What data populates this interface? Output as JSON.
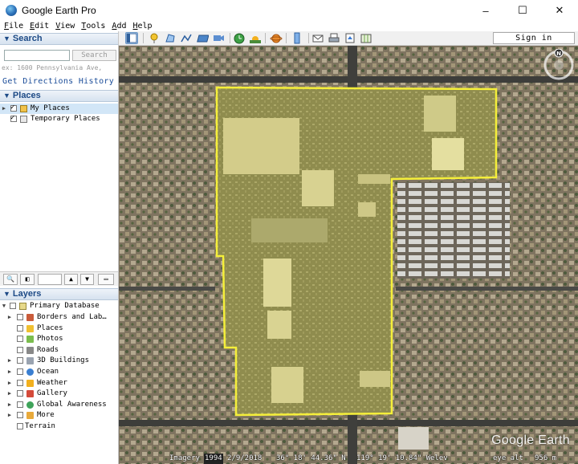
{
  "window": {
    "title": "Google Earth Pro",
    "controls": [
      "–",
      "☐",
      "✕"
    ]
  },
  "menu": {
    "items": [
      {
        "key": "F",
        "rest": "ile"
      },
      {
        "key": "E",
        "rest": "dit"
      },
      {
        "key": "V",
        "rest": "iew"
      },
      {
        "key": "T",
        "rest": "ools"
      },
      {
        "key": "A",
        "rest": "dd"
      },
      {
        "key": "H",
        "rest": "elp"
      }
    ]
  },
  "toolbar": {
    "sign_in_label": "Sign in",
    "icons": [
      "sidebar-toggle-icon",
      "placemark-icon",
      "polygon-icon",
      "path-icon",
      "image-overlay-icon",
      "record-tour-icon",
      "historical-imagery-icon",
      "sunlight-icon",
      "planets-icon",
      "ruler-icon",
      "email-icon",
      "print-icon",
      "save-image-icon",
      "view-in-maps-icon"
    ]
  },
  "search": {
    "header": "Search",
    "placeholder": "",
    "button_label": "Search",
    "hint": "ex: 1600 Pennsylvania Ave,",
    "get_directions": "Get Directions",
    "history": "History"
  },
  "places": {
    "header": "Places",
    "items": [
      {
        "label": "My Places",
        "checked": true,
        "selected": true
      },
      {
        "label": "Temporary Places",
        "checked": true,
        "selected": false
      }
    ]
  },
  "layers": {
    "header": "Layers",
    "root": "Primary Database",
    "items": [
      {
        "label": "Borders and Lab…",
        "icon": "borders-icon",
        "expandable": true
      },
      {
        "label": "Places",
        "icon": "places-layer-icon",
        "expandable": false
      },
      {
        "label": "Photos",
        "icon": "photos-icon",
        "expandable": false
      },
      {
        "label": "Roads",
        "icon": "roads-icon",
        "expandable": false
      },
      {
        "label": "3D Buildings",
        "icon": "buildings-icon",
        "expandable": true
      },
      {
        "label": "Ocean",
        "icon": "ocean-icon",
        "expandable": true
      },
      {
        "label": "Weather",
        "icon": "weather-icon",
        "expandable": true
      },
      {
        "label": "Gallery",
        "icon": "gallery-icon",
        "expandable": true
      },
      {
        "label": "Global Awareness",
        "icon": "global-awareness-icon",
        "expandable": true
      },
      {
        "label": "More",
        "icon": "more-icon",
        "expandable": true
      },
      {
        "label": "Terrain",
        "icon": "terrain-icon",
        "expandable": false
      }
    ]
  },
  "map": {
    "watermark": "Google Earth",
    "compass_label": "N",
    "status": {
      "imagery_label": "Imagery",
      "imagery_year": "1994",
      "imagery_date": "2/9/2018",
      "latitude": "36° 18' 44.36\" N",
      "longitude": "119° 19' 10.84\" W",
      "elev_label": "elev",
      "eye_alt_label": "eye alt",
      "eye_alt": "956 m"
    },
    "overlay_color": "#f5ef3a"
  }
}
